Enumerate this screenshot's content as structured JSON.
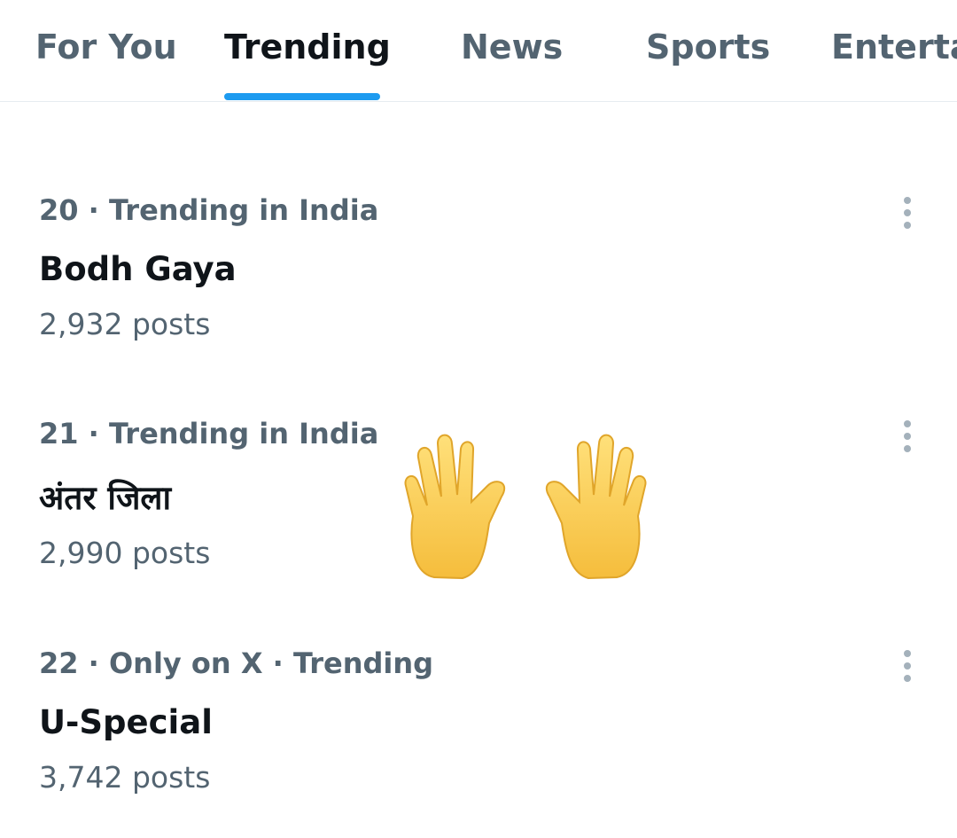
{
  "tabs": [
    {
      "label": "For You",
      "active": false
    },
    {
      "label": "Trending",
      "active": true
    },
    {
      "label": "News",
      "active": false
    },
    {
      "label": "Sports",
      "active": false
    },
    {
      "label": "Enterta",
      "active": false
    }
  ],
  "trends": [
    {
      "meta": "20 · Trending in India",
      "name": "Bodh Gaya",
      "count": "2,932 posts"
    },
    {
      "meta": "21 · Trending in India",
      "name": "अंतर जिला",
      "count": "2,990 posts"
    },
    {
      "meta": "22 · Only on X · Trending",
      "name": "U-Special",
      "count": "3,742 posts"
    }
  ],
  "overlay": {
    "emoji": "open-hands-emoji"
  },
  "colors": {
    "accent": "#1d9bf0",
    "primary_text": "#0f1419",
    "secondary_text": "#536471",
    "border": "#e6ecf0"
  }
}
